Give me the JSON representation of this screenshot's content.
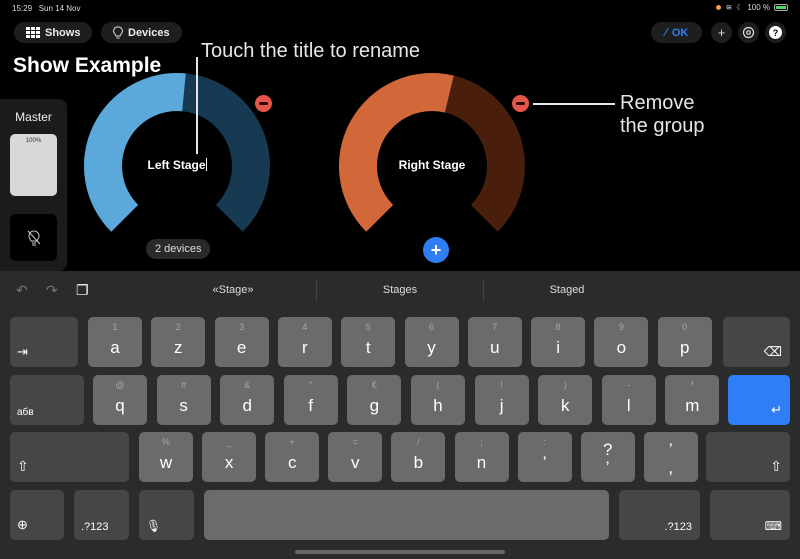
{
  "status_bar": {
    "time": "15:29",
    "date": "Sun 14 Nov",
    "battery": "100 %"
  },
  "nav": {
    "shows_label": "Shows",
    "devices_label": "Devices",
    "ok_label": "OK",
    "add_icon": "plus-icon",
    "settings_icon": "gear-icon",
    "help_icon": "question-icon"
  },
  "page": {
    "title": "Show Example"
  },
  "master": {
    "label": "Master",
    "level_text": "100%",
    "level": 1.0
  },
  "groups": [
    {
      "name": "Left Stage",
      "level": 0.52,
      "colors": {
        "fill": "#5aa9da",
        "track": "#163a52"
      },
      "devices_badge": "2 devices",
      "editing": true
    },
    {
      "name": "Right Stage",
      "level": 0.55,
      "colors": {
        "fill": "#d2683a",
        "track": "#4a1e0c"
      },
      "editing": false
    }
  ],
  "annotations": {
    "rename": "Touch the title to rename",
    "remove_line1": "Remove",
    "remove_line2": "the group"
  },
  "keyboard": {
    "suggestions": [
      "«Stage»",
      "Stages",
      "Staged"
    ],
    "row1": {
      "keys": [
        "a",
        "z",
        "e",
        "r",
        "t",
        "y",
        "u",
        "i",
        "o",
        "p"
      ],
      "hints": [
        "1",
        "2",
        "3",
        "4",
        "5",
        "6",
        "7",
        "8",
        "9",
        "0"
      ]
    },
    "row2": {
      "keys": [
        "q",
        "s",
        "d",
        "f",
        "g",
        "h",
        "j",
        "k",
        "l",
        "m"
      ],
      "hints": [
        "@",
        "#",
        "&",
        "\"",
        "€",
        "(",
        "!",
        ")",
        "-",
        "*"
      ]
    },
    "row3": {
      "keys": [
        "w",
        "x",
        "c",
        "v",
        "b",
        "n",
        "’",
        "?",
        "’"
      ],
      "subs": [
        "",
        "",
        "",
        "",
        "",
        "",
        "",
        "’",
        ","
      ],
      "hints": [
        "%",
        "_",
        "+",
        "=",
        "/",
        ";",
        ":",
        "",
        ""
      ]
    },
    "lang_label": "абв",
    "num_label": ".?123"
  }
}
